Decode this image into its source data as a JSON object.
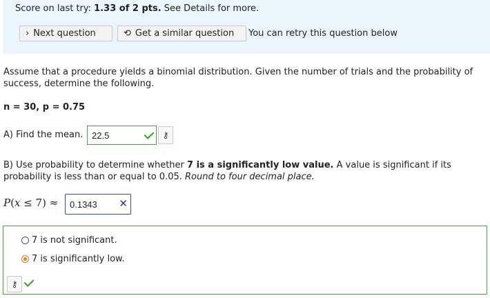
{
  "banner": {
    "score_prefix": "Score on last try:",
    "score_value": "1.33 of 2 pts.",
    "score_suffix": "See Details for more.",
    "next_label": "Next question",
    "similar_label": "Get a similar question",
    "retry_text": "You can retry this question below"
  },
  "question": {
    "intro": "Assume that a procedure yields a binomial distribution. Given the number of trials and the probability of success, determine the following.",
    "params": "n = 30, p = 0.75",
    "part_a_label": "A) Find the mean.",
    "part_a_answer": "22.5",
    "part_b_prefix": "B) Use probability to determine whether",
    "part_b_bold": "7 is a significantly low value.",
    "part_b_mid": "A value is significant if its probability is less than or equal to 0.05.",
    "part_b_italic": "Round to four decimal place.",
    "prob_p": "P",
    "prob_open": "(",
    "prob_x": "x",
    "prob_rest": " ≤ 7) ≈",
    "prob_answer": "0.1343"
  },
  "options": {
    "opt1": "7 is not significant.",
    "opt2": "7 is significantly low.",
    "selected_index": 1
  },
  "icons": {
    "next": "chevron-right-icon",
    "similar": "refresh-icon",
    "key": "key-icon",
    "correct": "checkmark-icon",
    "incorrect": "x-icon"
  },
  "colors": {
    "banner_bg": "#eaf6fb",
    "correct": "#49a33a",
    "incorrect": "#2a4fa8",
    "radio_selected": "#ec7f22"
  },
  "glyphs": {
    "chevron": "›",
    "refresh": "⟲",
    "key": "⚷",
    "x": "✕"
  }
}
